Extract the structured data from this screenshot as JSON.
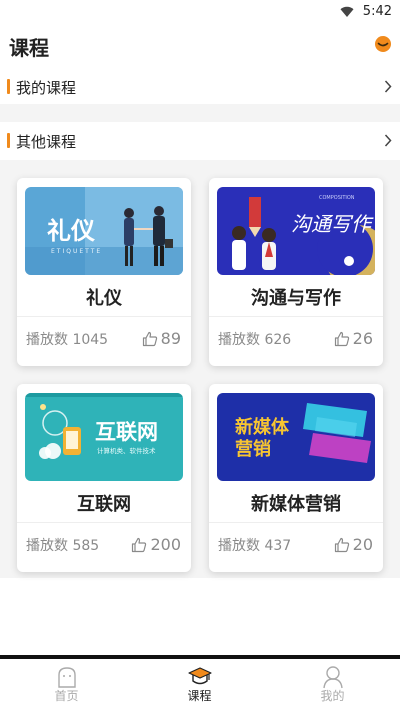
{
  "status_bar": {
    "time": "5:42"
  },
  "header": {
    "title": "课程",
    "chat_icon": "chat-bubble-icon"
  },
  "sections": {
    "my_courses": {
      "label": "我的课程"
    },
    "other_courses": {
      "label": "其他课程"
    }
  },
  "courses": [
    {
      "name": "礼仪",
      "plays": "播放数 1045",
      "likes": "89",
      "thumb_text": "礼仪",
      "thumb_sub": "ETIQUETTE"
    },
    {
      "name": "沟通与写作",
      "plays": "播放数 626",
      "likes": "26",
      "thumb_text": "沟通写作",
      "thumb_sub": "COMPOSITION"
    },
    {
      "name": "互联网",
      "plays": "播放数 585",
      "likes": "200",
      "thumb_text": "互联网",
      "thumb_sub": "计算机类、软件技术"
    },
    {
      "name": "新媒体营销",
      "plays": "播放数 437",
      "likes": "20",
      "thumb_text": "新媒体",
      "thumb_text2": "营销"
    }
  ],
  "tabs": [
    {
      "label": "首页",
      "icon": "home-icon",
      "active": false
    },
    {
      "label": "课程",
      "icon": "graduation-cap-icon",
      "active": true
    },
    {
      "label": "我的",
      "icon": "profile-icon",
      "active": false
    }
  ],
  "colors": {
    "accent": "#f08a1c",
    "text": "#222222",
    "muted": "#8a8a8a"
  }
}
